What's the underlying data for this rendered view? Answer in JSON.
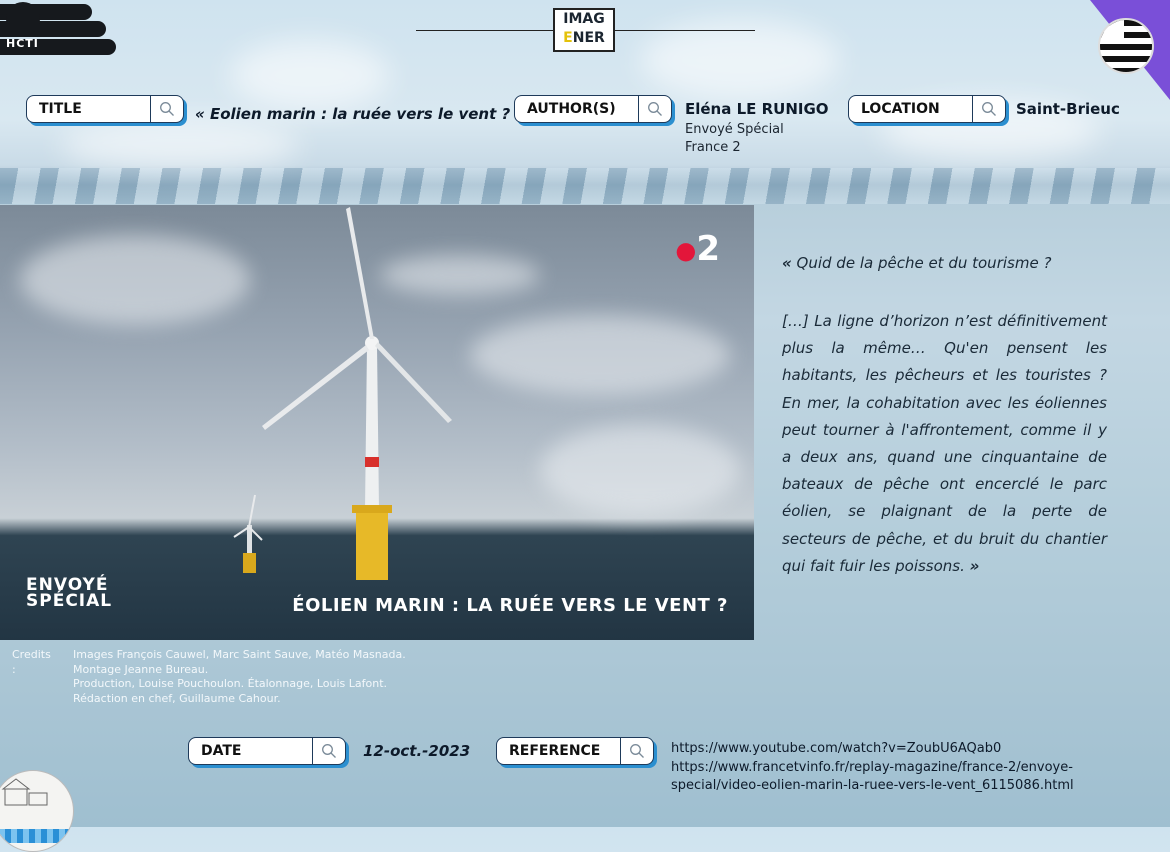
{
  "header": {
    "logo_text": "HCTI",
    "brand_line1": "IMAG",
    "brand_line2_e": "E",
    "brand_line2_rest": "NER"
  },
  "fields": {
    "title_label": "TITLE",
    "title_value": "« Eolien marin : la ruée vers le vent ? »",
    "author_label": "AUTHOR(S)",
    "author_name": "Eléna LE RUNIGO",
    "author_line2": "Envoyé Spécial",
    "author_line3": "France 2",
    "location_label": "LOCATION",
    "location_value": "Saint-Brieuc",
    "date_label": "DATE",
    "date_value": "12-oct.-2023",
    "reference_label": "REFERENCE"
  },
  "video": {
    "channel_number": "2",
    "show_line1": "ENVOYÉ",
    "show_line2": "SPÉCIAL",
    "headline": "ÉOLIEN MARIN : LA RUÉE VERS LE VENT ?"
  },
  "quote": {
    "open_mark": "«",
    "heading": "Quid de la pêche et du tourisme ?",
    "body": "[…] La ligne d’horizon n’est définitivement plus la même… Qu'en pensent les habitants, les pêcheurs et les touristes ? En mer, la cohabitation avec les éoliennes peut tourner à l'affrontement, comme il y a deux ans, quand une cinquantaine de bateaux de pêche ont encerclé le parc éolien, se plaignant de la perte de secteurs de pêche, et du bruit du chantier qui fait fuir les poissons.",
    "close_mark": "»"
  },
  "credits": {
    "label": "Credits :",
    "lines": [
      "Images François Cauwel, Marc Saint Sauve, Matéo Masnada.",
      "Montage Jeanne Bureau.",
      "Production, Louise Pouchoulon. Étalonnage, Louis Lafont.",
      "Rédaction en chef, Guillaume Cahour."
    ]
  },
  "references": [
    "https://www.youtube.com/watch?v=ZoubU6AQab0",
    "https://www.francetvinfo.fr/replay-magazine/france-2/envoye-",
    "special/video-eolien-marin-la-ruee-vers-le-vent_6115086.html"
  ],
  "colors": {
    "pill_shadow": "#2b8fd0",
    "brand_accent": "#e4c20a",
    "corner": "#7a4fd8",
    "channel_dot": "#e3163a"
  },
  "icons": [
    "magnifier-icon",
    "brittany-flag-icon",
    "hcti-logo-icon",
    "city-badge-icon"
  ]
}
